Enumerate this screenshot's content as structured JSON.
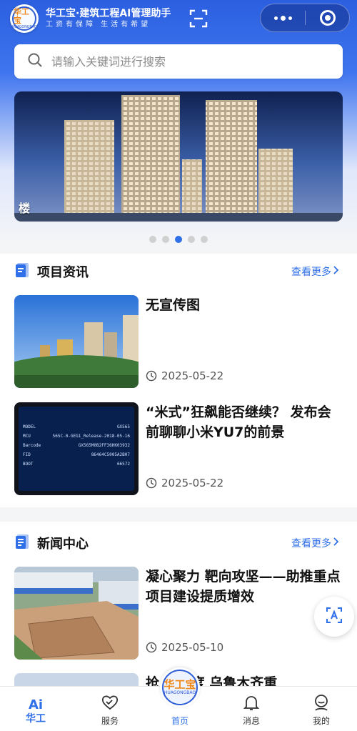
{
  "header": {
    "logo_text": "华工宝",
    "logo_sub": "HUAGONGBAO",
    "title": "华工宝·建筑工程AI管理助手",
    "slogan": "工资有保障 生活有希望"
  },
  "search": {
    "placeholder": "请输入关键词进行搜索"
  },
  "banner": {
    "caption": "楼",
    "slide_count": 5,
    "active_index": 2
  },
  "project_news": {
    "title": "项目资讯",
    "more_label": "查看更多",
    "items": [
      {
        "title": "无宣传图",
        "date": "2025-05-22"
      },
      {
        "title": "“米式”狂飙能否继续？ 发布会前聊聊小米YU7的前景",
        "date": "2025-05-22",
        "screen_rows": [
          {
            "k": "MODEL",
            "v": "GX565"
          },
          {
            "k": "MCU",
            "v": "565C-0-GEG1_Release-2018-05-16"
          },
          {
            "k": "Barcode",
            "v": "GX565M0B2FF36HK03932"
          },
          {
            "k": "FID",
            "v": "86464C5005A2B07"
          },
          {
            "k": "BOOT",
            "v": "66572"
          }
        ]
      }
    ]
  },
  "news_center": {
    "title": "新闻中心",
    "more_label": "查看更多",
    "items": [
      {
        "title": "凝心聚力 靶向攻坚——助推重点项目建设提质增效",
        "date": "2025-05-10"
      },
      {
        "title": "抢 抓进度 乌鲁木齐重",
        "date": ""
      }
    ]
  },
  "tabbar": {
    "ai_top": "Ai",
    "ai_bottom": "华工",
    "service": "服务",
    "home": "首页",
    "messages": "消息",
    "mine": "我的"
  },
  "colors": {
    "primary": "#2f6fe8",
    "header": "#2b5fe0",
    "accent": "#f08a1c"
  }
}
